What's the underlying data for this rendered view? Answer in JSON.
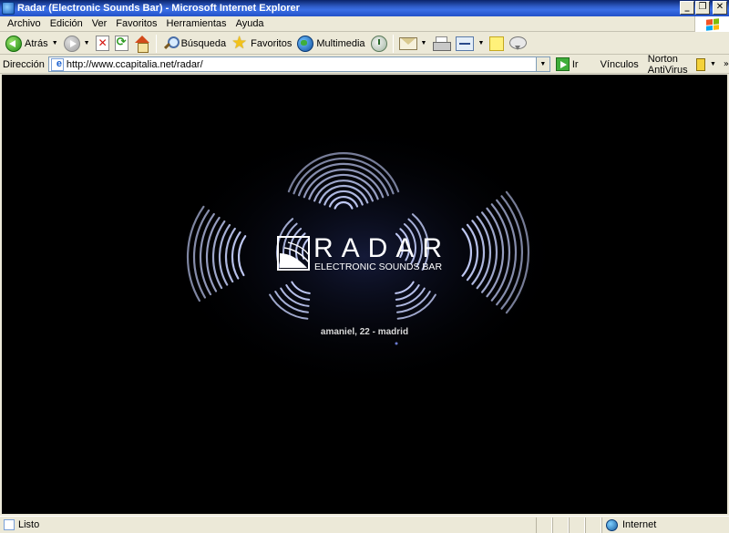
{
  "window": {
    "title": "Radar (Electronic Sounds Bar) - Microsoft Internet Explorer",
    "minimize_glyph": "_",
    "maximize_glyph": "❐",
    "close_glyph": "✕"
  },
  "menu": [
    {
      "label": "Archivo"
    },
    {
      "label": "Edición"
    },
    {
      "label": "Ver"
    },
    {
      "label": "Favoritos"
    },
    {
      "label": "Herramientas"
    },
    {
      "label": "Ayuda"
    }
  ],
  "toolbar": {
    "back_label": "Atrás",
    "search_label": "Búsqueda",
    "favorites_label": "Favoritos",
    "media_label": "Multimedia",
    "dropdown_glyph": "▼"
  },
  "address": {
    "label": "Dirección",
    "url": "http://www.ccapitalia.net/radar/",
    "go_label": "Ir",
    "links_label": "Vínculos",
    "norton_label": "Norton AntiVirus",
    "more_glyph": "»"
  },
  "page": {
    "logo_text": "RADAR",
    "logo_subtitle": "ELECTRONIC SOUNDS BAR",
    "address_line": "amaniel, 22 - madrid",
    "background_color": "#000000",
    "ring_color": "#c8d2ff"
  },
  "status": {
    "text": "Listo",
    "zone": "Internet"
  }
}
